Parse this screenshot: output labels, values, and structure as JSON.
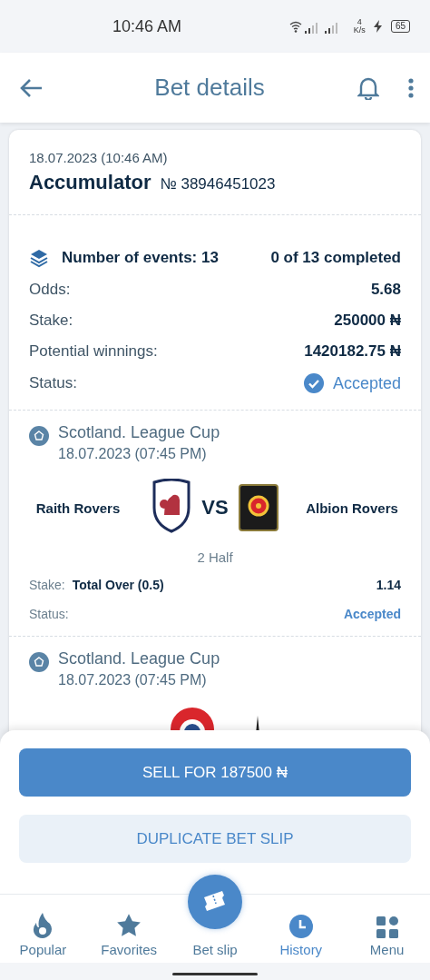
{
  "status_bar": {
    "time": "10:46 AM",
    "speed_value": "4",
    "speed_unit": "K/s",
    "battery": "65"
  },
  "header": {
    "title": "Bet details"
  },
  "bet": {
    "date": "18.07.2023 (10:46 AM)",
    "type": "Accumulator",
    "number": "№ 38946451023"
  },
  "summary": {
    "events": "Number of events: 13",
    "completed": "0 of 13 completed",
    "rows": [
      {
        "label": "Odds:",
        "value": "5.68",
        "kind": "text"
      },
      {
        "label": "Stake:",
        "value": "250000 ₦",
        "kind": "text"
      },
      {
        "label": "Potential winnings:",
        "value": "1420182.75 ₦",
        "kind": "text"
      },
      {
        "label": "Status:",
        "value": "Accepted",
        "kind": "status"
      }
    ]
  },
  "events": [
    {
      "league": "Scotland. League Cup",
      "datetime": "18.07.2023 (07:45 PM)",
      "home": "Raith Rovers",
      "vs": "VS",
      "away": "Albion Rovers",
      "period": "2 Half",
      "stake_label": "Stake:",
      "bet": "Total Over (0.5)",
      "odds": "1.14",
      "status_label": "Status:",
      "status": "Accepted"
    },
    {
      "league": "Scotland. League Cup",
      "datetime": "18.07.2023 (07:45 PM)"
    }
  ],
  "actions": [
    {
      "label": "SELL FOR 187500 ₦",
      "kind": "primary"
    },
    {
      "label": "DUPLICATE BET SLIP",
      "kind": "secondary"
    }
  ],
  "nav": [
    {
      "label": "Popular",
      "kind": "flame",
      "selected": false
    },
    {
      "label": "Favorites",
      "kind": "star",
      "selected": false
    },
    {
      "label": "Bet slip",
      "kind": "ticket",
      "selected": false
    },
    {
      "label": "History",
      "kind": "clock",
      "selected": true
    },
    {
      "label": "Menu",
      "kind": "grid",
      "selected": false
    }
  ]
}
